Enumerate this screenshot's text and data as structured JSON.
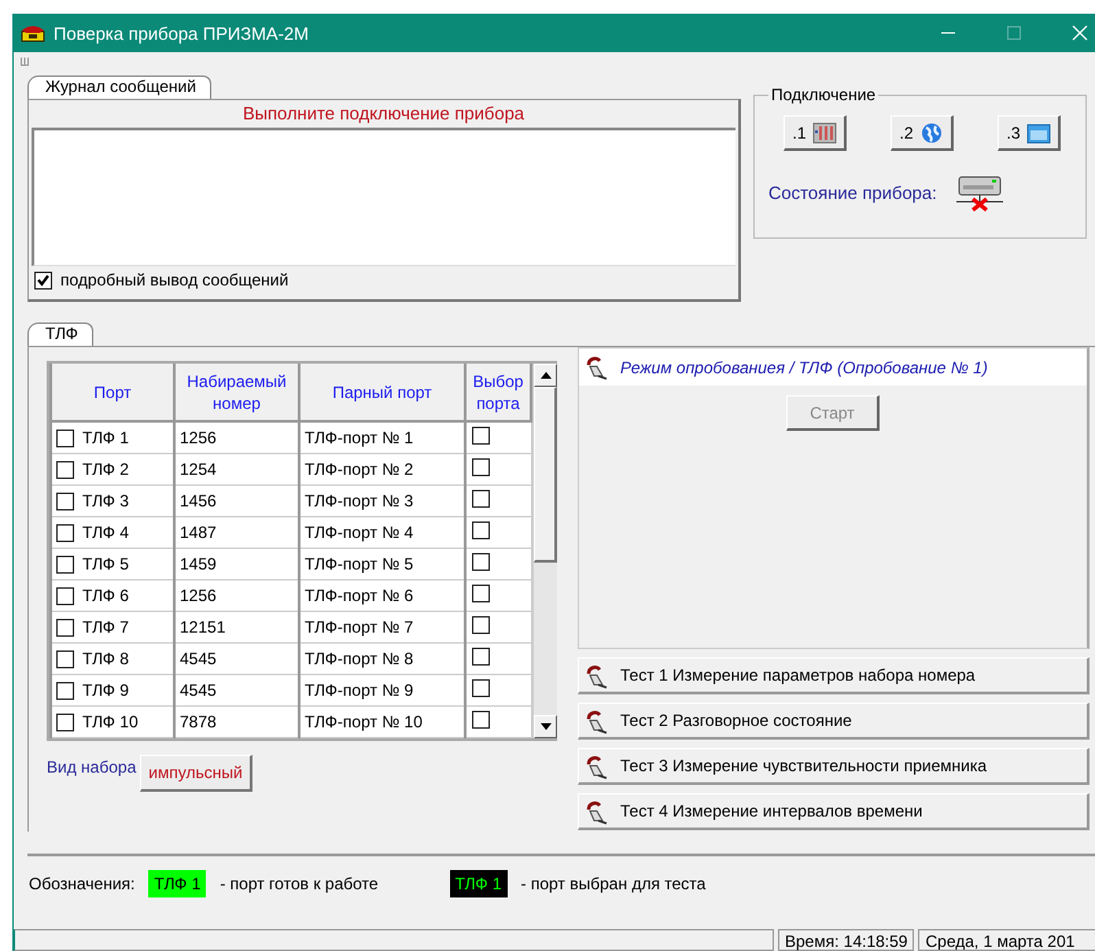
{
  "window": {
    "title": "Поверка прибора ПРИЗМА-2М"
  },
  "journal": {
    "tab": {
      "label": "Журнал сообщений",
      "selected": true
    },
    "prompt": "Выполните подключение прибора",
    "verbose": {
      "label": "подробный вывод сообщений",
      "checked": true
    }
  },
  "connection": {
    "title": "Подключение",
    "buttons": [
      {
        "label": ".1",
        "kind": "rack"
      },
      {
        "label": ".2",
        "kind": "globe"
      },
      {
        "label": ".3",
        "kind": "window"
      }
    ],
    "state_label": "Состояние прибора:",
    "device_connected": false
  },
  "tlf": {
    "tab": {
      "label": "ТЛФ",
      "selected": true
    },
    "table": {
      "columns": [
        "Порт",
        "Набираемый номер",
        "Парный порт",
        "Выбор порта"
      ],
      "rows": [
        {
          "port": "ТЛФ 1",
          "checked": false,
          "number": "1256",
          "pair": "ТЛФ-порт № 1",
          "chosen": false
        },
        {
          "port": "ТЛФ 2",
          "checked": false,
          "number": "1254",
          "pair": "ТЛФ-порт № 2",
          "chosen": false
        },
        {
          "port": "ТЛФ 3",
          "checked": false,
          "number": "1456",
          "pair": "ТЛФ-порт № 3",
          "chosen": false
        },
        {
          "port": "ТЛФ 4",
          "checked": false,
          "number": "1487",
          "pair": "ТЛФ-порт № 4",
          "chosen": false
        },
        {
          "port": "ТЛФ 5",
          "checked": false,
          "number": "1459",
          "pair": "ТЛФ-порт № 5",
          "chosen": false
        },
        {
          "port": "ТЛФ 6",
          "checked": false,
          "number": "1256",
          "pair": "ТЛФ-порт № 6",
          "chosen": false
        },
        {
          "port": "ТЛФ 7",
          "checked": false,
          "number": "12151",
          "pair": "ТЛФ-порт № 7",
          "chosen": false
        },
        {
          "port": "ТЛФ 8",
          "checked": false,
          "number": "4545",
          "pair": "ТЛФ-порт № 8",
          "chosen": false
        },
        {
          "port": "ТЛФ 9",
          "checked": false,
          "number": "4545",
          "pair": "ТЛФ-порт № 9",
          "chosen": false
        },
        {
          "port": "ТЛФ 10",
          "checked": false,
          "number": "7878",
          "pair": "ТЛФ-порт № 10",
          "chosen": false
        }
      ]
    },
    "dial_type": {
      "label": "Вид набора",
      "value": "импульсный"
    }
  },
  "tests": [
    {
      "label": "Режим опробованиея / ТЛФ (Опробование № 1)",
      "expanded": true,
      "start_button": {
        "label": "Старт",
        "disabled": true
      }
    },
    {
      "label": "Тест 1 Измерение параметров набора номера",
      "expanded": false
    },
    {
      "label": "Тест 2 Разговорное состояние",
      "expanded": false
    },
    {
      "label": "Тест 3 Измерение чувствительности приемника",
      "expanded": false
    },
    {
      "label": "Тест 4 Измерение интервалов времени",
      "expanded": false
    }
  ],
  "legend": {
    "title": "Обозначения:",
    "items": [
      {
        "badge": "ТЛФ 1",
        "kind": "ready",
        "description": "- порт готов к работе"
      },
      {
        "badge": "ТЛФ 1",
        "kind": "chosen",
        "description": "- порт выбран для теста"
      }
    ]
  },
  "status_bar": {
    "time": "Время: 14:18:59",
    "date": "Среда, 1 марта 201"
  }
}
